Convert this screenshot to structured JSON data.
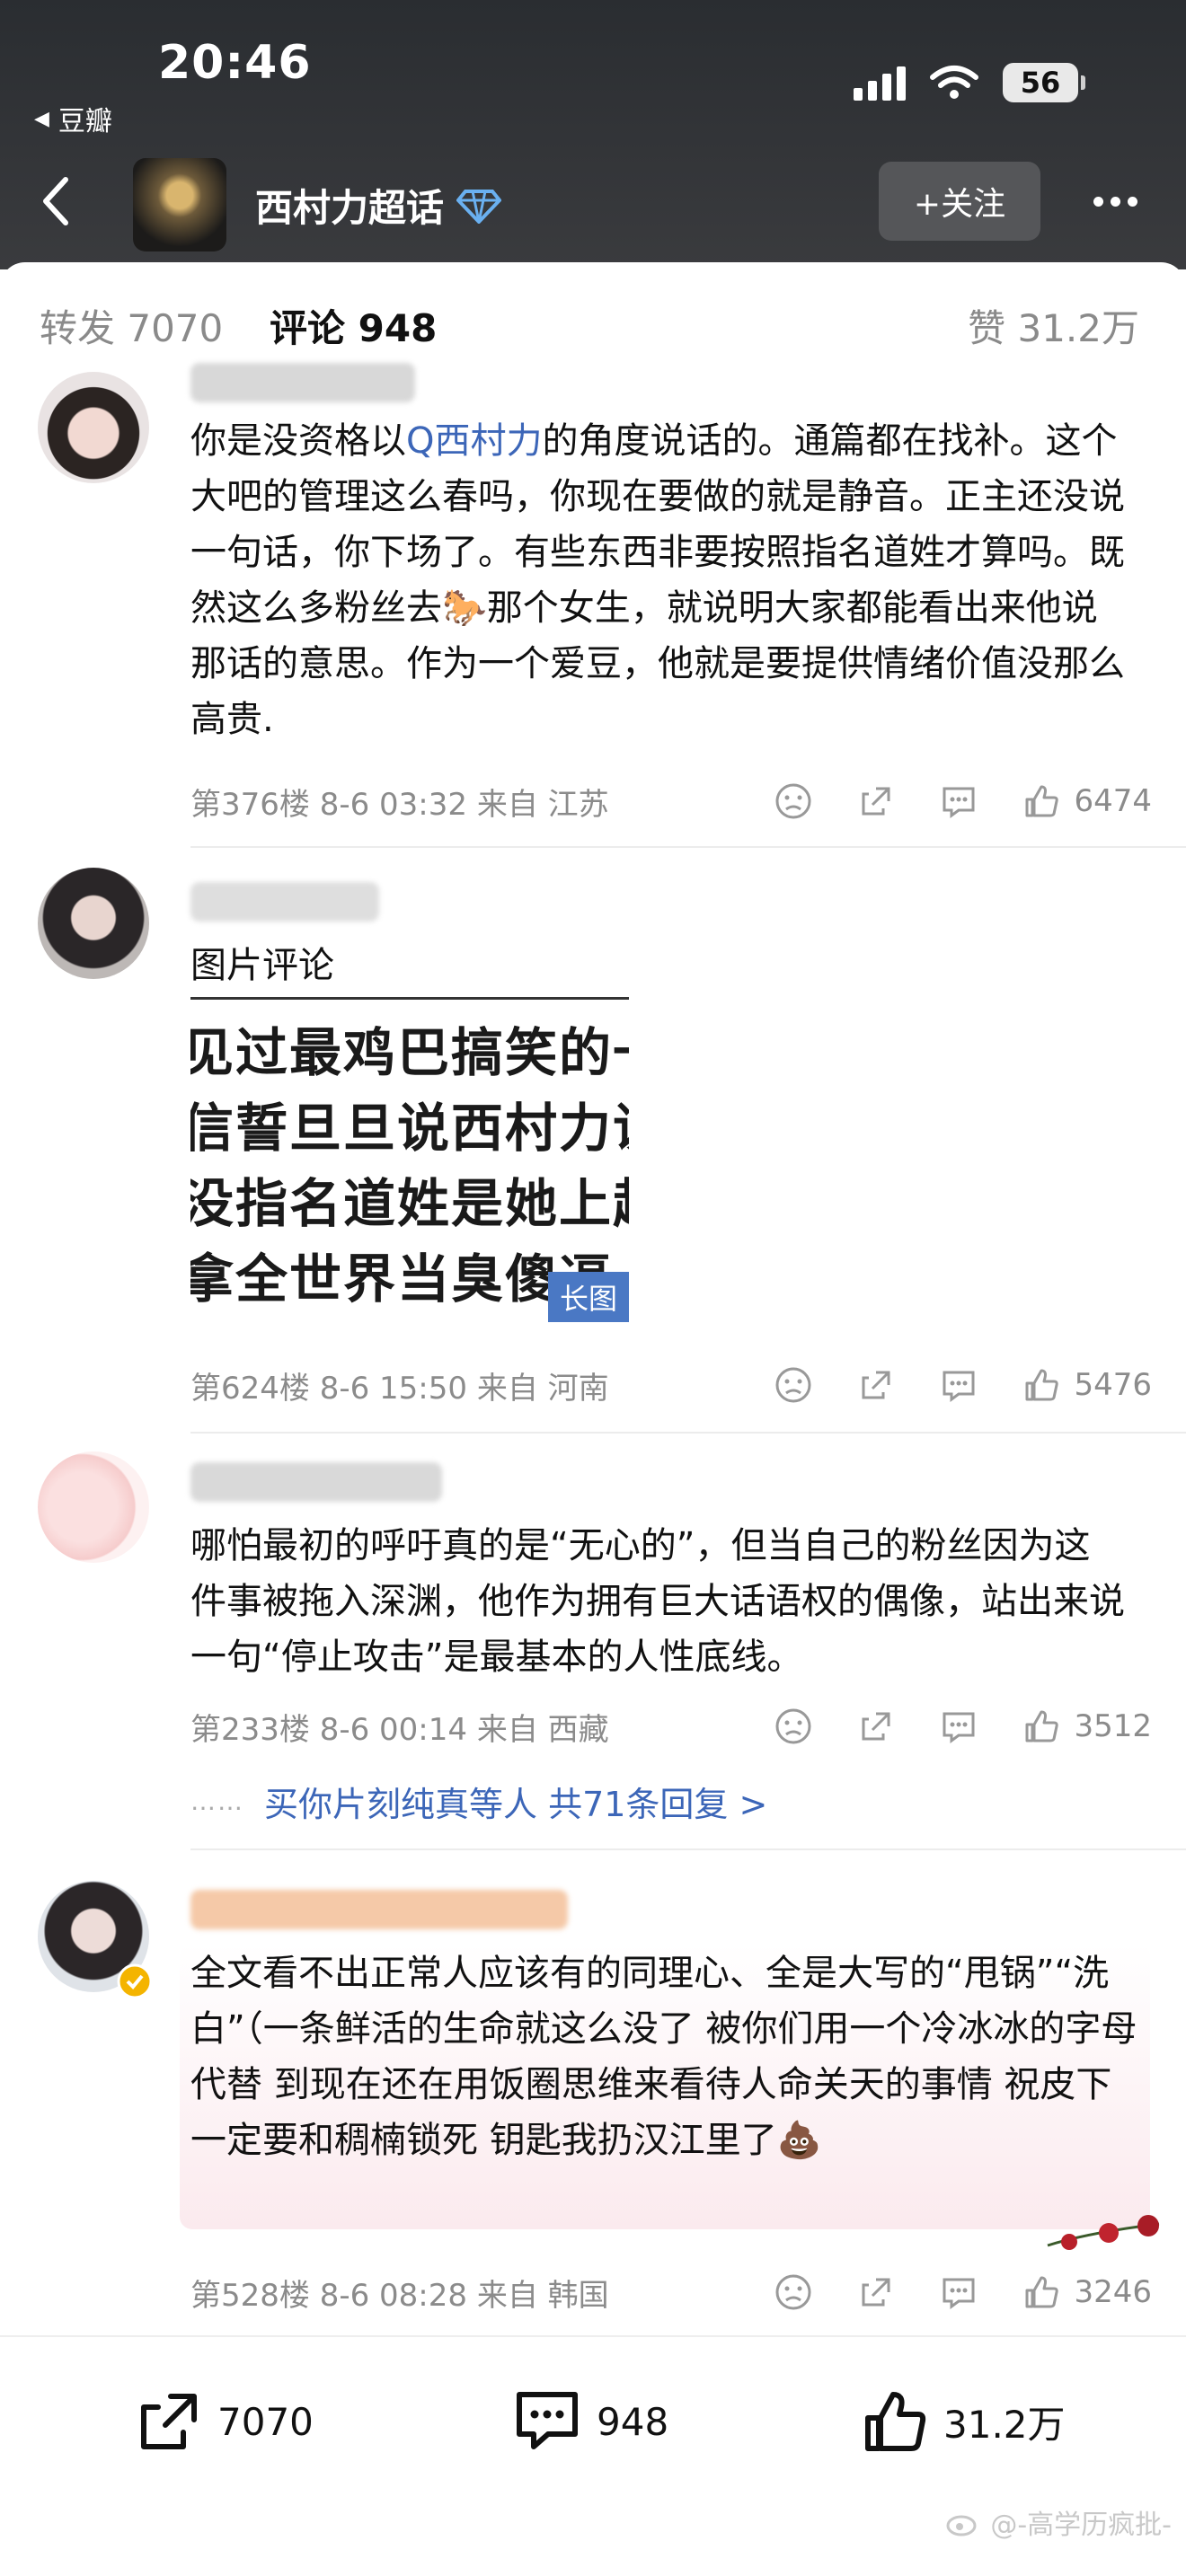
{
  "status_bar": {
    "time": "20:46",
    "back_app": "豆瓣",
    "battery": "56"
  },
  "header": {
    "title": "西村力超话",
    "follow_label": "+关注"
  },
  "tabs": {
    "repost": "转发 7070",
    "comment": "评论 948",
    "like": "赞 31.2万"
  },
  "comments": [
    {
      "text_prefix": "你是没资格以",
      "link": "Q西村力",
      "text_suffix": "的角度说话的。通篇都在找补。这个大吧的管理这么春吗，你现在要做的就是静音。正主还没说一句话，你下场了。有些东西非要按照指名道姓才算吗。既然这么多粉丝去🐎那个女生，就说明大家都能看出来他说那话的意思。作为一个爱豆，他就是要提供情绪价值没那么高贵.",
      "meta": "第376楼 8-6 03:32 来自 江苏",
      "likes": "6474"
    },
    {
      "image_label": "图片评论",
      "image_lines": [
        "见过最鸡巴搞笑的一",
        "信誓旦旦说西村力说",
        "没指名道姓是她上赶",
        "拿全世界当臭傻逼"
      ],
      "long_badge": "长图",
      "meta": "第624楼 8-6 15:50 来自 河南",
      "likes": "5476"
    },
    {
      "text": "哪怕最初的呼吁真的是“无心的”，但当自己的粉丝因为这件事被拖入深渊，他作为拥有巨大话语权的偶像，站出来说一句“停止攻击”是最基本的人性底线。",
      "meta": "第233楼 8-6 00:14 来自 西藏",
      "likes": "3512",
      "replies": "买你片刻纯真等人  共71条回复 >"
    },
    {
      "text": "全文看不出正常人应该有的同理心、全是大写的“甩锅”“洗白”（一条鲜活的生命就这么没了 被你们用一个冷冰冰的字母代替 到现在还在用饭圈思维来看待人命关天的事情 祝皮下一定要和稠楠锁死 钥匙我扔汉江里了💩",
      "meta": "第528楼 8-6 08:28 来自 韩国",
      "likes": "3246"
    }
  ],
  "bottom_bar": {
    "repost": "7070",
    "comment": "948",
    "like": "31.2万"
  },
  "watermark": "@-高学历疯批-"
}
